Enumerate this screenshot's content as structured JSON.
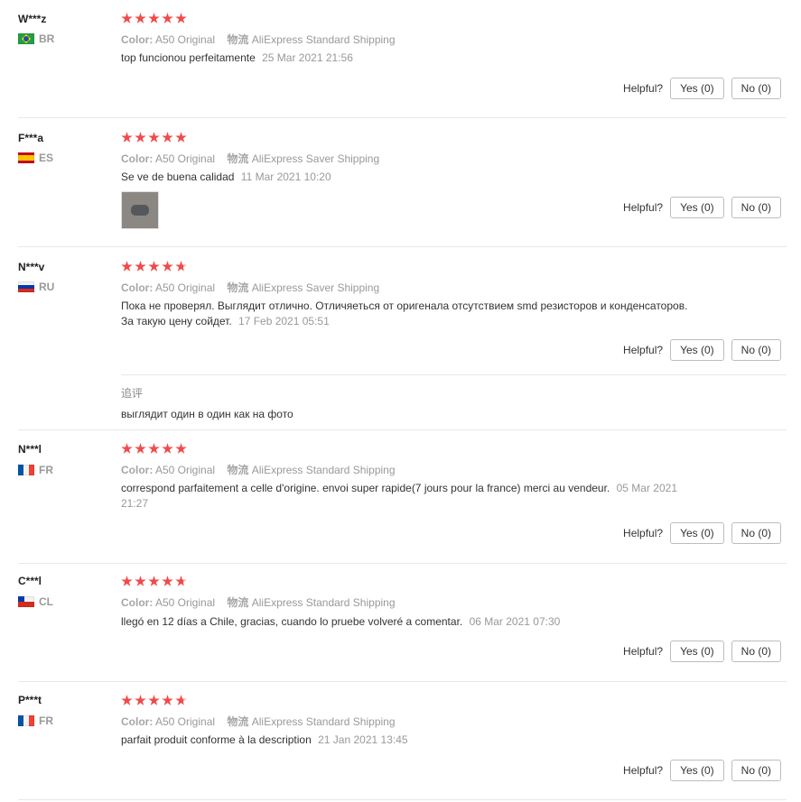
{
  "labels": {
    "color_key": "Color:",
    "shipping_key": "物流",
    "helpful": "Helpful?",
    "yes": "Yes (0)",
    "no": "No (0)",
    "followup": "追评"
  },
  "colors": {
    "star": "#f04b4b",
    "muted": "#999999",
    "border": "#e8e8e8"
  },
  "reviews": [
    {
      "user": "W***z",
      "country": "BR",
      "stars": 5,
      "color": "A50 Original",
      "shipping": "AliExpress Standard Shipping",
      "text": "top funcionou perfeitamente",
      "date": "25 Mar 2021 21:56"
    },
    {
      "user": "F***a",
      "country": "ES",
      "stars": 5,
      "color": "A50 Original",
      "shipping": "AliExpress Saver Shipping",
      "text": "Se ve de buena calidad",
      "date": "11 Mar 2021 10:20",
      "photo_icon": "photo-thumbnail"
    },
    {
      "user": "N***v",
      "country": "RU",
      "stars": 4.7,
      "color": "A50 Original",
      "shipping": "AliExpress Saver Shipping",
      "text_line1": "Пока не проверял. Выглядит отлично. Отличяеться от оригенала отсутствием smd резисторов и конденсаторов.",
      "text_line2": "За такую цену сойдет.",
      "date": "17 Feb 2021 05:51",
      "followup": "выглядит один в один как на фото"
    },
    {
      "user": "N***l",
      "country": "FR",
      "stars": 5,
      "color": "A50 Original",
      "shipping": "AliExpress Standard Shipping",
      "text": "correspond parfaitement a celle d'origine. envoi super rapide(7 jours pour la france) merci au vendeur.",
      "date_line1": "05 Mar 2021",
      "date_line2": "21:27"
    },
    {
      "user": "C***l",
      "country": "CL",
      "stars": 4.7,
      "color": "A50 Original",
      "shipping": "AliExpress Standard Shipping",
      "text": "llegó en 12 días a Chile, gracias, cuando lo pruebe volveré a comentar.",
      "date": "06 Mar 2021 07:30"
    },
    {
      "user": "P***t",
      "country": "FR",
      "stars": 4.7,
      "color": "A50 Original",
      "shipping": "AliExpress Standard Shipping",
      "text": "parfait produit conforme à la description",
      "date": "21 Jan 2021 13:45"
    }
  ]
}
